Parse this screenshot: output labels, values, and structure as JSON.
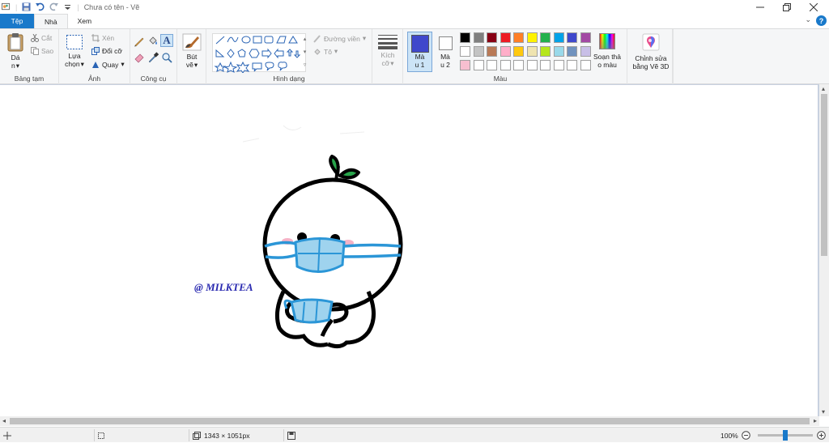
{
  "title_bar": {
    "title": "Chưa có tên - Vẽ",
    "icons": [
      "paint-app-icon",
      "save-icon",
      "undo-icon",
      "redo-icon",
      "customize-icon"
    ]
  },
  "tabs": [
    {
      "label": "Tệp"
    },
    {
      "label": "Nhà"
    },
    {
      "label": "Xem"
    }
  ],
  "ribbon": {
    "clipboard": {
      "group_label": "Bảng tạm",
      "paste_line1": "Dá",
      "paste_line2": "n",
      "cut": "Cắt",
      "copy": "Sao"
    },
    "image": {
      "group_label": "Ảnh",
      "select_line1": "Lựa",
      "select_line2": "chọn",
      "crop": "Xén",
      "resize": "Đổi cỡ",
      "rotate": "Quay"
    },
    "tools": {
      "group_label": "Công cụ"
    },
    "brushes": {
      "line1": "Bút",
      "line2": "vẽ"
    },
    "shapes": {
      "group_label": "Hình dạng",
      "outline": "Đường viền",
      "fill": "Tô"
    },
    "size": {
      "line1": "Kích",
      "line2": "cỡ"
    },
    "colors": {
      "group_label": "Màu",
      "color1_line1": "Mà",
      "color1_line2": "u 1",
      "color2_line1": "Mà",
      "color2_line2": "u 2",
      "color1_value": "#3f48cc",
      "color2_value": "#ffffff",
      "palette_row1": [
        "#000000",
        "#7f7f7f",
        "#880015",
        "#ed1c24",
        "#ff7f27",
        "#fff200",
        "#22b14c",
        "#00a2e8",
        "#3f48cc",
        "#a349a4"
      ],
      "palette_row2": [
        "#ffffff",
        "#c3c3c3",
        "#b97a57",
        "#ffaec9",
        "#ffc90e",
        "#efe4b0",
        "#b5e61d",
        "#99d9ea",
        "#7092be",
        "#c8bfe7"
      ],
      "palette_row3": [
        "#f7bfd0",
        "#ffffff",
        "#ffffff",
        "#ffffff",
        "#ffffff",
        "#ffffff",
        "#ffffff",
        "#ffffff",
        "#ffffff",
        "#ffffff"
      ],
      "edit_colors_line1": "Soạn thả",
      "edit_colors_line2": "o màu",
      "paint3d_line1": "Chỉnh sửa",
      "paint3d_line2": "bằng Vẽ 3D"
    }
  },
  "canvas": {
    "watermark": "@ MILKTEA"
  },
  "status": {
    "dimensions": "1343 × 1051px",
    "zoom": "100%",
    "zoom_level": 0.5
  }
}
